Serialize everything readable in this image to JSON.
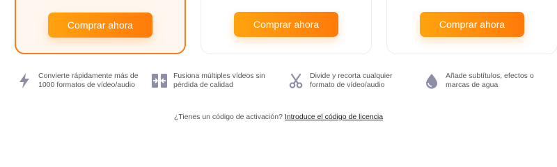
{
  "plans": [
    {
      "buy_label": "Comprar ahora",
      "selected": true
    },
    {
      "buy_label": "Comprar ahora",
      "selected": false
    },
    {
      "buy_label": "Comprar ahora",
      "selected": false
    }
  ],
  "features": [
    {
      "icon": "lightning-icon",
      "line1": "Convierte rápidamente más de",
      "line2": "1000 formatos de vídeo/audio"
    },
    {
      "icon": "merge-icon",
      "line1": "Fusiona múltiples vídeos sin",
      "line2": "pérdida de calidad"
    },
    {
      "icon": "scissors-icon",
      "line1": "Divide y recorta cualquier",
      "line2": "formato de vídeo/audio"
    },
    {
      "icon": "droplet-icon",
      "line1": "Añade subtítulos, efectos o",
      "line2": "marcas de agua"
    }
  ],
  "activation": {
    "question": "¿Tienes un código de activación?",
    "link": "Introduce el código de licencia"
  },
  "colors": {
    "accent": "#f97d1c",
    "button_start": "#ffa30f",
    "button_end": "#ff7a0a",
    "icon": "#8e8ea6"
  }
}
